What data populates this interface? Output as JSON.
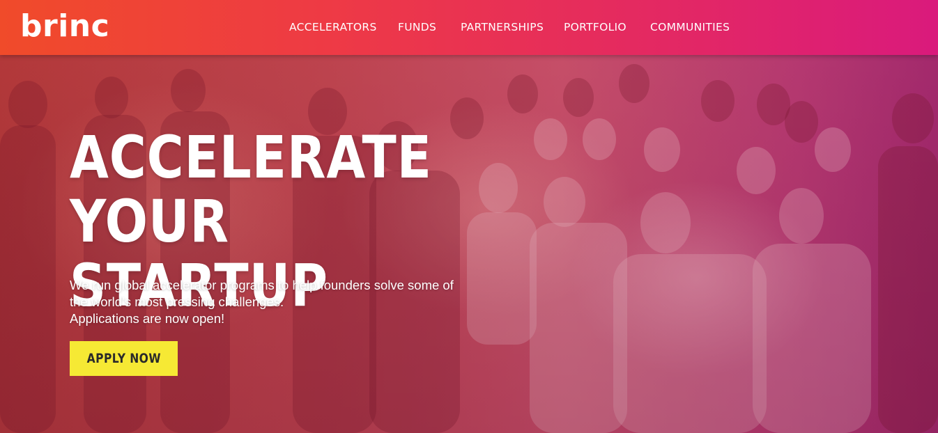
{
  "brand": {
    "logo_text": "brinc"
  },
  "nav": {
    "items": [
      {
        "label": "ACCELERATORS"
      },
      {
        "label": "FUNDS"
      },
      {
        "label": "PARTNERSHIPS"
      },
      {
        "label": "PORTFOLIO"
      },
      {
        "label": "COMMUNITIES"
      }
    ]
  },
  "hero": {
    "headline_line1": "ACCELERATE",
    "headline_line2": "YOUR STARTUP",
    "description_line1": "We run global accelerator programs to help founders solve some of",
    "description_line2": "the world’s most pressing challenges.",
    "description_line3": "Applications are now open!",
    "cta_label": "APPLY NOW"
  },
  "colors": {
    "header_gradient_start": "#f04b2a",
    "header_gradient_end": "#da1a7c",
    "cta_background": "#f6e934",
    "cta_text": "#2a2a2a",
    "text_light": "#ffffff"
  }
}
